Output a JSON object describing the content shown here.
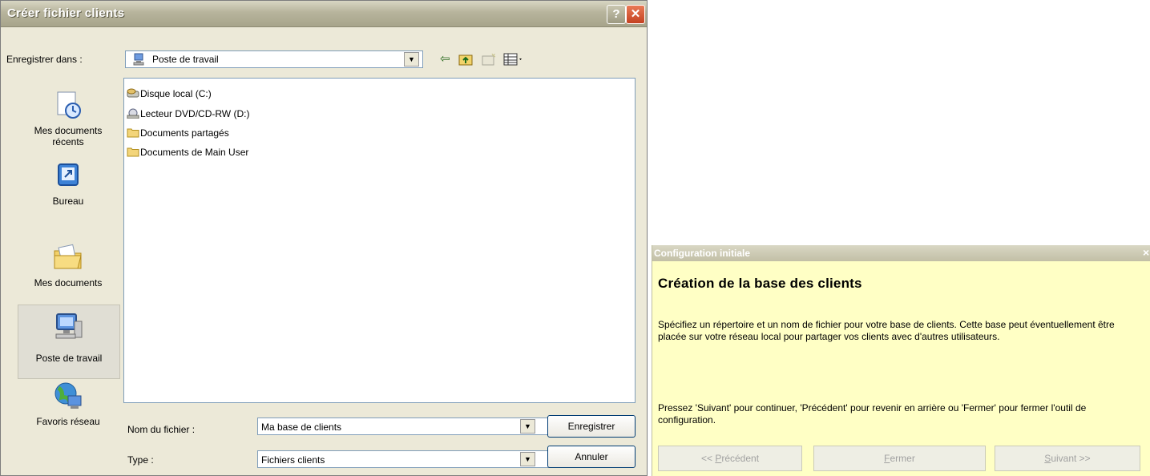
{
  "save_dialog": {
    "title": "Créer fichier clients",
    "help_button": "?",
    "close_button": "✕",
    "save_in_label": "Enregistrer dans :",
    "save_in_value": "Poste de travail",
    "places": [
      {
        "label": "Mes documents récents"
      },
      {
        "label": "Bureau"
      },
      {
        "label": "Mes documents"
      },
      {
        "label": "Poste de travail"
      },
      {
        "label": "Favoris réseau"
      }
    ],
    "files": [
      {
        "name": "Disque local (C:)",
        "icon": "hard-drive-icon"
      },
      {
        "name": "Lecteur DVD/CD-RW (D:)",
        "icon": "dvd-drive-icon"
      },
      {
        "name": "Documents partagés",
        "icon": "folder-icon"
      },
      {
        "name": "Documents de Main User",
        "icon": "folder-icon"
      }
    ],
    "filename_label": "Nom du fichier :",
    "filename_value": "Ma base de clients",
    "type_label": "Type :",
    "type_value": "Fichiers clients",
    "save_button": "Enregistrer",
    "cancel_button": "Annuler"
  },
  "config_panel": {
    "title": "Configuration initiale",
    "close": "×",
    "heading": "Création de la base des clients",
    "paragraph1": "Spécifiez un répertoire et un nom de fichier pour votre base de clients. Cette base peut éventuellement être placée sur votre réseau local pour partager vos clients avec d'autres utilisateurs.",
    "paragraph2": "Pressez 'Suivant' pour continuer, 'Précédent' pour revenir en arrière ou 'Fermer' pour fermer l'outil de configuration.",
    "prev_prefix": "<< ",
    "prev_access": "P",
    "prev_rest": "récédent",
    "close_access": "F",
    "close_rest": "ermer",
    "next_access": "S",
    "next_rest": "uivant >>"
  },
  "colors": {
    "panel_background": "#ffffc5",
    "dialog_background": "#ece9d8",
    "close_button": "#d7502a"
  }
}
